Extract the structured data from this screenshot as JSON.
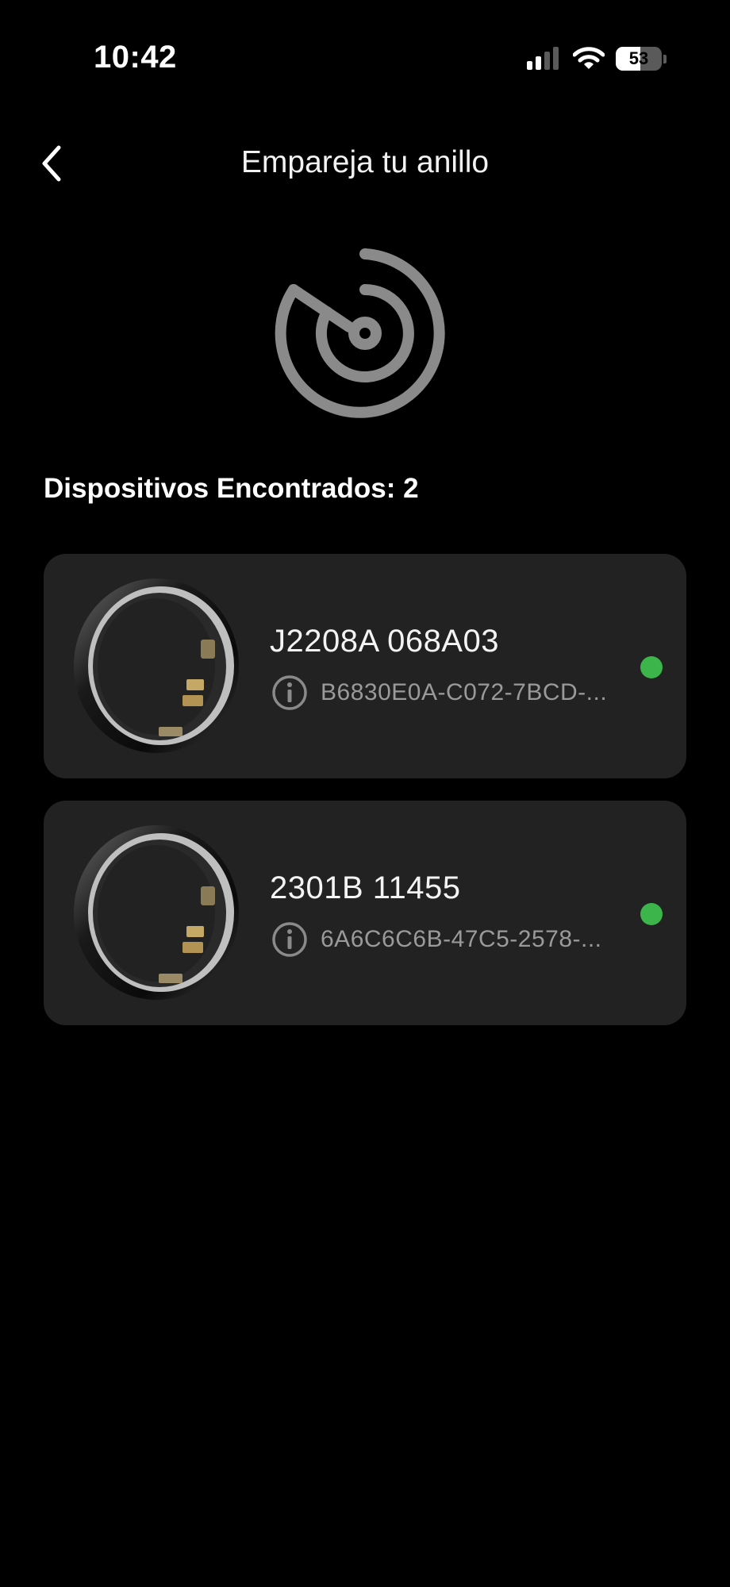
{
  "status_bar": {
    "time": "10:42",
    "battery_level": "53",
    "battery_fraction": 0.53,
    "signal_bars_active": 2,
    "signal_bars_total": 4
  },
  "header": {
    "title": "Empareja tu anillo",
    "back_icon": "chevron-left-icon"
  },
  "scan": {
    "icon": "radar-icon",
    "found_label": "Dispositivos Encontrados: 2"
  },
  "devices": [
    {
      "name": "J2208A 068A03",
      "id": "B6830E0A-C072-7BCD-...",
      "status_color": "#3cb54a"
    },
    {
      "name": "2301B 11455",
      "id": "6A6C6C6B-47C5-2578-...",
      "status_color": "#3cb54a"
    }
  ],
  "colors": {
    "background": "#000000",
    "card": "#222222",
    "icon_gray": "#8a8a8a",
    "status_green": "#3cb54a"
  }
}
